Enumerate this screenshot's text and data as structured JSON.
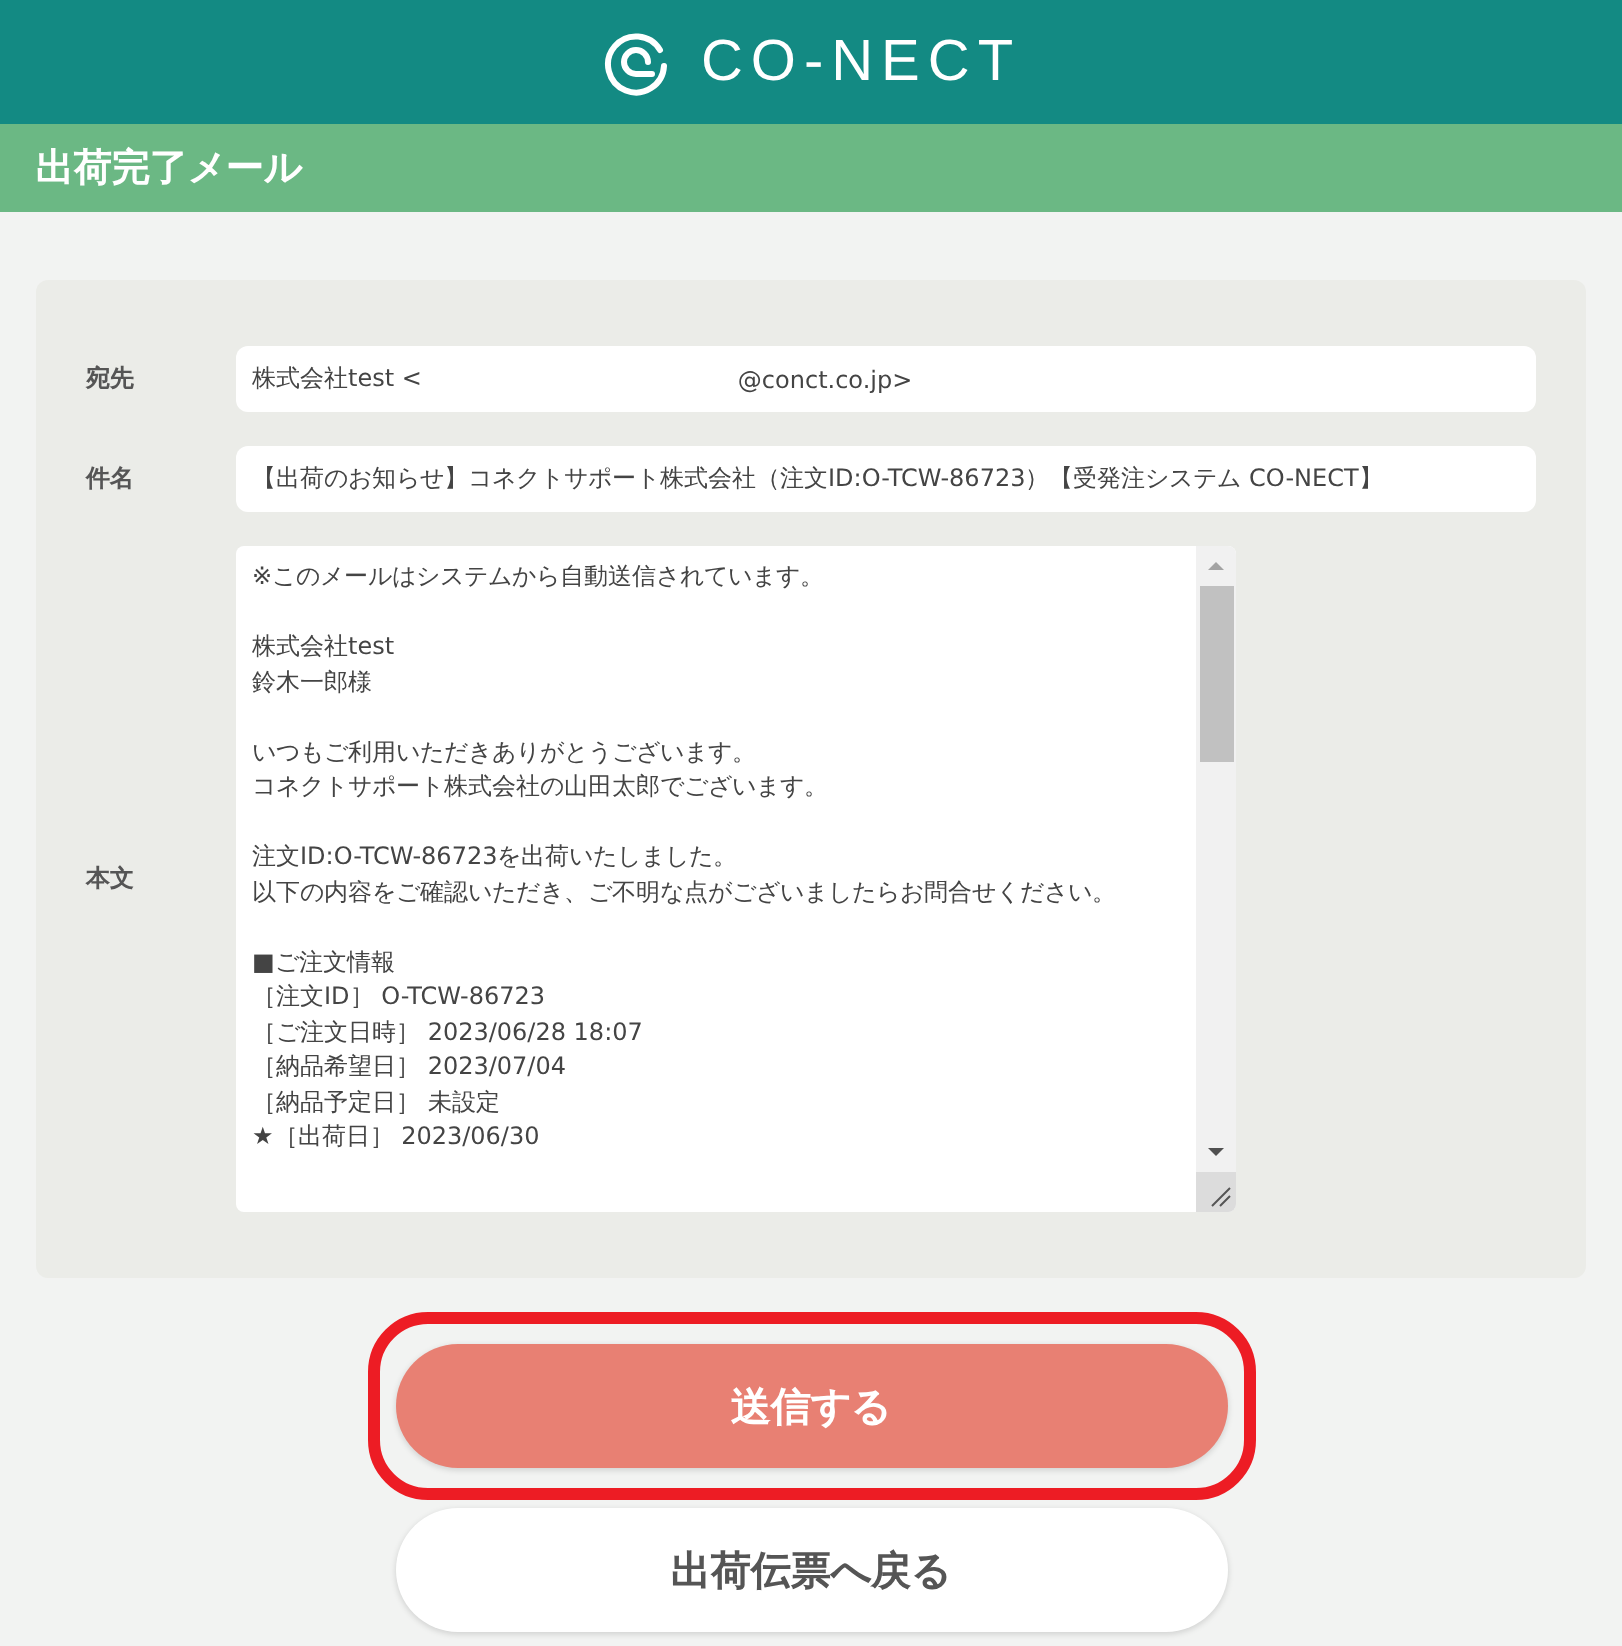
{
  "header": {
    "logo_text": "CO-NECT"
  },
  "page_title": "出荷完了メール",
  "form": {
    "to": {
      "label": "宛先",
      "value_start": "株式会社test <",
      "value_end": "@conct.co.jp>"
    },
    "subject": {
      "label": "件名",
      "value": "【出荷のお知らせ】コネクトサポート株式会社（注文ID:O-TCW-86723）【受発注システム CO-NECT】"
    },
    "body": {
      "label": "本文",
      "paragraphs": [
        [
          "※このメールはシステムから自動送信されています。"
        ],
        [
          "株式会社test",
          "鈴木一郎様"
        ],
        [
          "いつもご利用いただきありがとうございます。",
          "コネクトサポート株式会社の山田太郎でございます。"
        ],
        [
          "注文ID:O-TCW-86723を出荷いたしました。",
          "以下の内容をご確認いただき、ご不明な点がございましたらお問合せください。"
        ],
        [
          "■ご注文情報",
          "［注文ID］ O-TCW-86723",
          "［ご注文日時］ 2023/06/28 18:07",
          "［納品希望日］ 2023/07/04",
          "［納品予定日］ 未設定",
          "★［出荷日］ 2023/06/30"
        ]
      ]
    }
  },
  "buttons": [
    {
      "label": "送信する",
      "kind": "primary",
      "highlighted": true
    },
    {
      "label": "出荷伝票へ戻る",
      "kind": "secondary",
      "highlighted": false
    }
  ]
}
